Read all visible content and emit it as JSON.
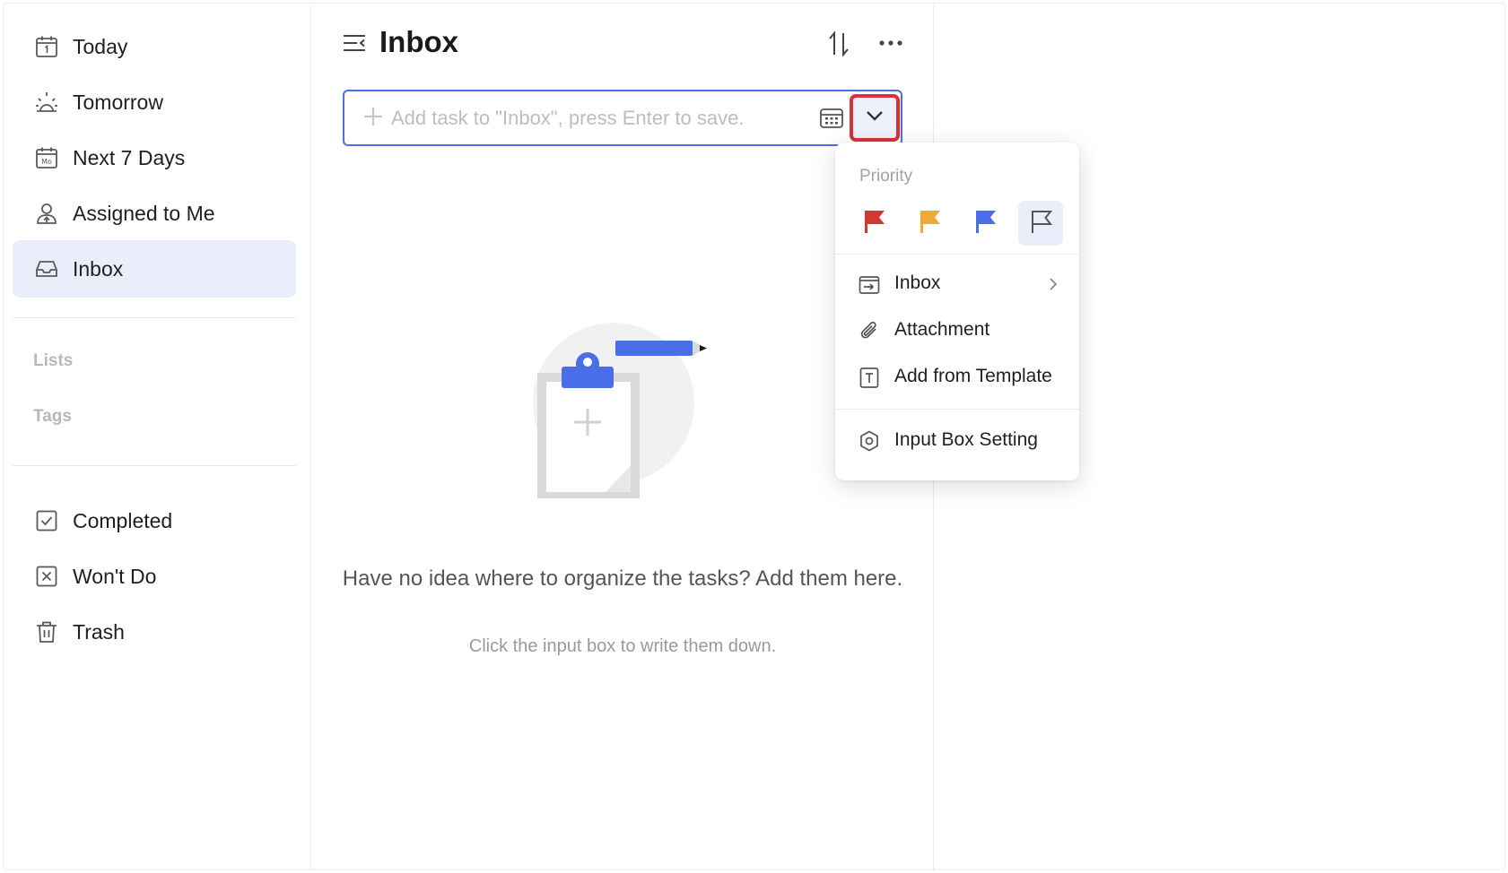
{
  "sidebar": {
    "items": [
      {
        "label": "Today",
        "icon": "calendar-today-icon"
      },
      {
        "label": "Tomorrow",
        "icon": "sunrise-icon"
      },
      {
        "label": "Next 7 Days",
        "icon": "calendar-week-icon"
      },
      {
        "label": "Assigned to Me",
        "icon": "user-assigned-icon"
      },
      {
        "label": "Inbox",
        "icon": "inbox-icon",
        "active": true
      }
    ],
    "sections": {
      "lists": "Lists",
      "tags": "Tags"
    },
    "footer_items": [
      {
        "label": "Completed",
        "icon": "checkbox-icon"
      },
      {
        "label": "Won't Do",
        "icon": "x-box-icon"
      },
      {
        "label": "Trash",
        "icon": "trash-icon"
      }
    ]
  },
  "main": {
    "title": "Inbox",
    "input_placeholder": "Add task to \"Inbox\", press Enter to save.",
    "empty_title": "Have no idea where to organize the tasks? Add them here.",
    "empty_subtitle": "Click the input box to write them down."
  },
  "popup": {
    "priority_label": "Priority",
    "flags": [
      {
        "name": "high",
        "color": "#d33a2f"
      },
      {
        "name": "medium",
        "color": "#f1a937"
      },
      {
        "name": "low",
        "color": "#4a6ee8"
      },
      {
        "name": "none",
        "color": "#555555",
        "selected": true
      }
    ],
    "items": [
      {
        "label": "Inbox",
        "icon": "inbox-move-icon",
        "chevron": true
      },
      {
        "label": "Attachment",
        "icon": "paperclip-icon"
      },
      {
        "label": "Add from Template",
        "icon": "template-icon"
      }
    ],
    "setting_label": "Input Box Setting"
  },
  "colors": {
    "accent": "#4b6fe6",
    "highlight": "#d93239",
    "active_bg": "#eaeefb"
  }
}
